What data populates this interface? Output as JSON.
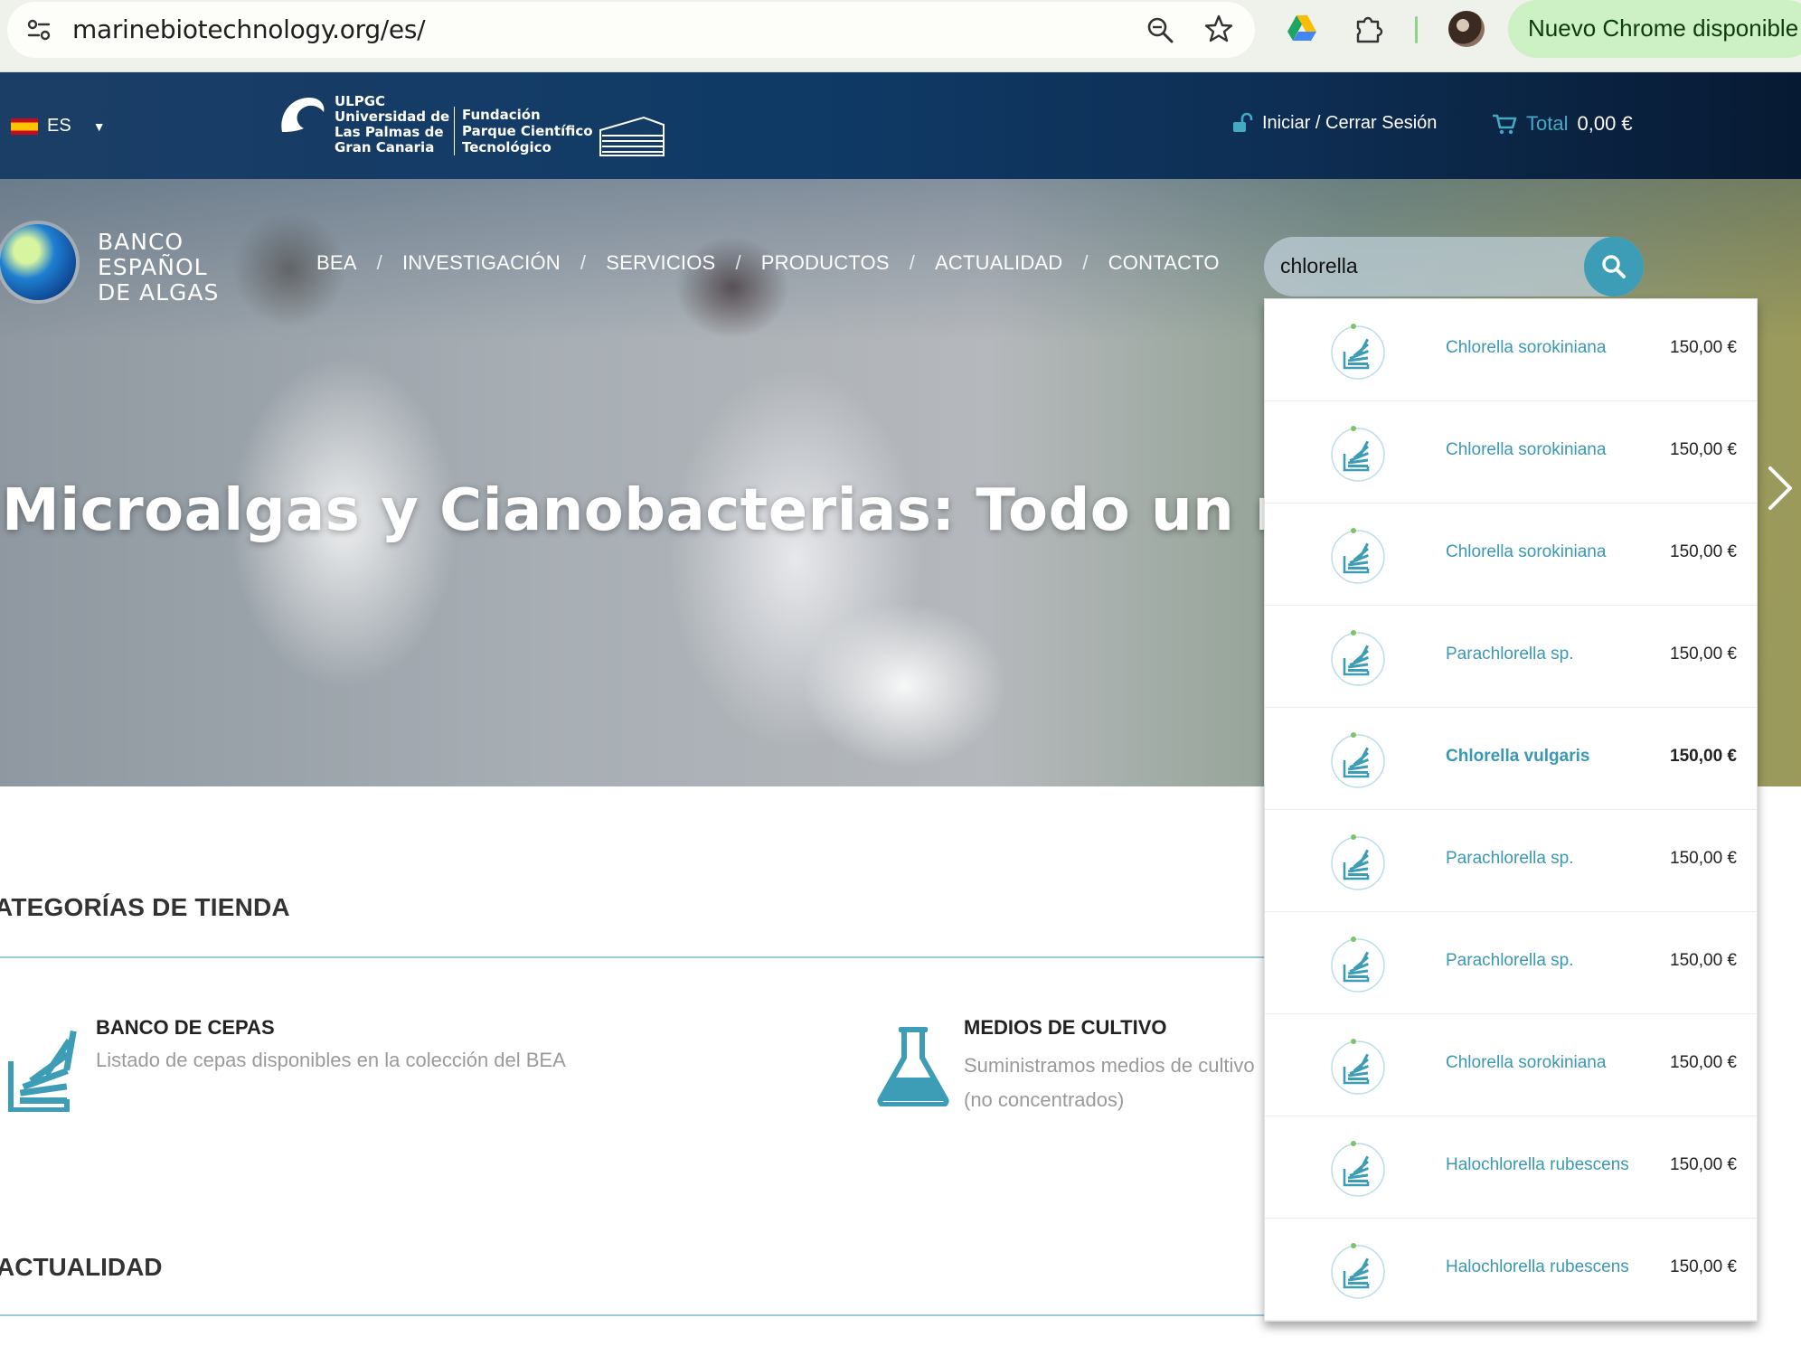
{
  "browser": {
    "url": "marinebiotechnology.org/es/",
    "update_chip": "Nuevo Chrome disponible"
  },
  "header": {
    "language": "ES",
    "ulpgc_lines": [
      "ULPGC",
      "Universidad de",
      "Las Palmas de",
      "Gran Canaria"
    ],
    "fpct_lines": [
      "Fundación",
      "Parque Científico",
      "Tecnológico"
    ],
    "login_label": "Iniciar / Cerrar Sesión",
    "cart_label": "Total",
    "cart_amount": "0,00 €"
  },
  "brand": {
    "lines": [
      "BANCO",
      "ESPAÑOL",
      "DE ALGAS"
    ]
  },
  "nav": {
    "items": [
      "BEA",
      "INVESTIGACIÓN",
      "SERVICIOS",
      "PRODUCTOS",
      "ACTUALIDAD",
      "CONTACTO"
    ],
    "separator": "/"
  },
  "search": {
    "value": "chlorella"
  },
  "hero": {
    "title": "Microalgas y Cianobacterias: Todo un mundo"
  },
  "suggestions": [
    {
      "name": "Chlorella sorokiniana",
      "price": "150,00 €",
      "active": false
    },
    {
      "name": "Chlorella sorokiniana",
      "price": "150,00 €",
      "active": false
    },
    {
      "name": "Chlorella sorokiniana",
      "price": "150,00 €",
      "active": false
    },
    {
      "name": "Parachlorella sp.",
      "price": "150,00 €",
      "active": false
    },
    {
      "name": "Chlorella vulgaris",
      "price": "150,00 €",
      "active": true
    },
    {
      "name": "Parachlorella sp.",
      "price": "150,00 €",
      "active": false
    },
    {
      "name": "Parachlorella sp.",
      "price": "150,00 €",
      "active": false
    },
    {
      "name": "Chlorella sorokiniana",
      "price": "150,00 €",
      "active": false
    },
    {
      "name": "Halochlorella rubescens",
      "price": "150,00 €",
      "active": false
    },
    {
      "name": "Halochlorella rubescens",
      "price": "150,00 €",
      "active": false
    }
  ],
  "categories": {
    "heading": "ATEGORÍAS DE TIENDA",
    "banco": {
      "title": "BANCO DE CEPAS",
      "desc": "Listado de cepas disponibles en la colección del BEA"
    },
    "medios": {
      "title": "MEDIOS DE CULTIVO",
      "desc": "Suministramos medios de cultivo (no concentrados)"
    }
  },
  "actualidad": {
    "heading": "ACTUALIDAD"
  },
  "colors": {
    "accent": "#3d9db7",
    "link": "#3a98b4",
    "header_bg": "#0f3a66",
    "chip_bg": "#cdf0c4"
  },
  "icons": [
    "site-info-icon",
    "zoom-icon",
    "star-icon",
    "drive-icon",
    "extension-icon",
    "avatar",
    "flag-es-icon",
    "caret-down-icon",
    "unlock-icon",
    "cart-icon",
    "search-icon",
    "chevron-right-icon",
    "strain-bank-icon",
    "flask-icon"
  ]
}
